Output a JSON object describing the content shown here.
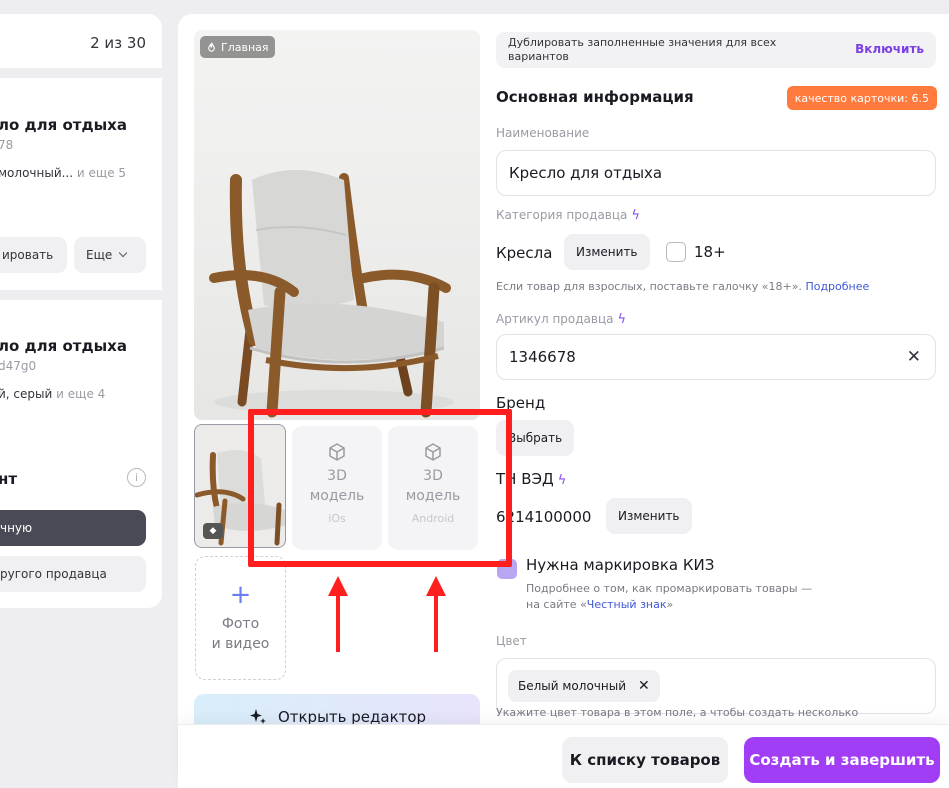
{
  "left_panel": {
    "counter": "2 из 30",
    "card1": {
      "title": "ло для отдыха",
      "sku": "78",
      "meta_main": "молочный...",
      "meta_more": "и еще 5",
      "edit_label": "ировать",
      "more_label": "Еще"
    },
    "card2": {
      "title": "ло для отдыха",
      "sku": "d47g0",
      "meta_main": "й, серый",
      "meta_more": "и еще 4"
    },
    "card3": {
      "title": "нт",
      "info_icon": "i",
      "manual_label": "чную",
      "other_seller_label": "ругого продавца"
    }
  },
  "media": {
    "main_badge": "Главная",
    "models": [
      {
        "label_top": "3D",
        "label_bottom": "модель",
        "os": "iOs"
      },
      {
        "label_top": "3D",
        "label_bottom": "модель",
        "os": "Android"
      }
    ],
    "add_plus": "+",
    "add_line1": "Фото",
    "add_line2": "и видео",
    "editor_label": "Открыть редактор"
  },
  "form": {
    "duplicate_text": "Дублировать заполненные значения для всех вариантов",
    "duplicate_action": "Включить",
    "section_title": "Основная информация",
    "quality_badge": "качество карточки: 6.5",
    "name_label": "Наименование",
    "name_value": "Кресло для отдыха",
    "category_label": "Категория продавца",
    "category_value": "Кресла",
    "category_change": "Изменить",
    "adult_label": "18+",
    "adult_hint_text": "Если товар для взрослых, поставьте галочку «18+».",
    "adult_hint_link": "Подробнее",
    "sku_label": "Артикул продавца",
    "sku_value": "1346678",
    "clear_icon": "✕",
    "brand_label": "Бренд",
    "brand_button": "Выбрать",
    "tnved_label": "ТН ВЭД",
    "tnved_value": "6214100000",
    "tnved_change": "Изменить",
    "kiz_label": "Нужна маркировка КИЗ",
    "kiz_hint_line1": "Подробнее о том, как промаркировать товары —",
    "kiz_hint_prefix": "на сайте «",
    "kiz_hint_link": "Честный знак",
    "kiz_hint_suffix": "»",
    "color_label": "Цвет",
    "color_chip": "Белый молочный",
    "color_chip_remove": "✕",
    "color_hint": "Укажите цвет товара в этом поле, а чтобы создать несколько"
  },
  "footer": {
    "back_label": "К списку товаров",
    "create_label": "Создать и завершить"
  },
  "colors": {
    "accent_purple": "#a03df5",
    "quality_orange": "#ff7a3d",
    "annotation_red": "#ff1f1f"
  }
}
